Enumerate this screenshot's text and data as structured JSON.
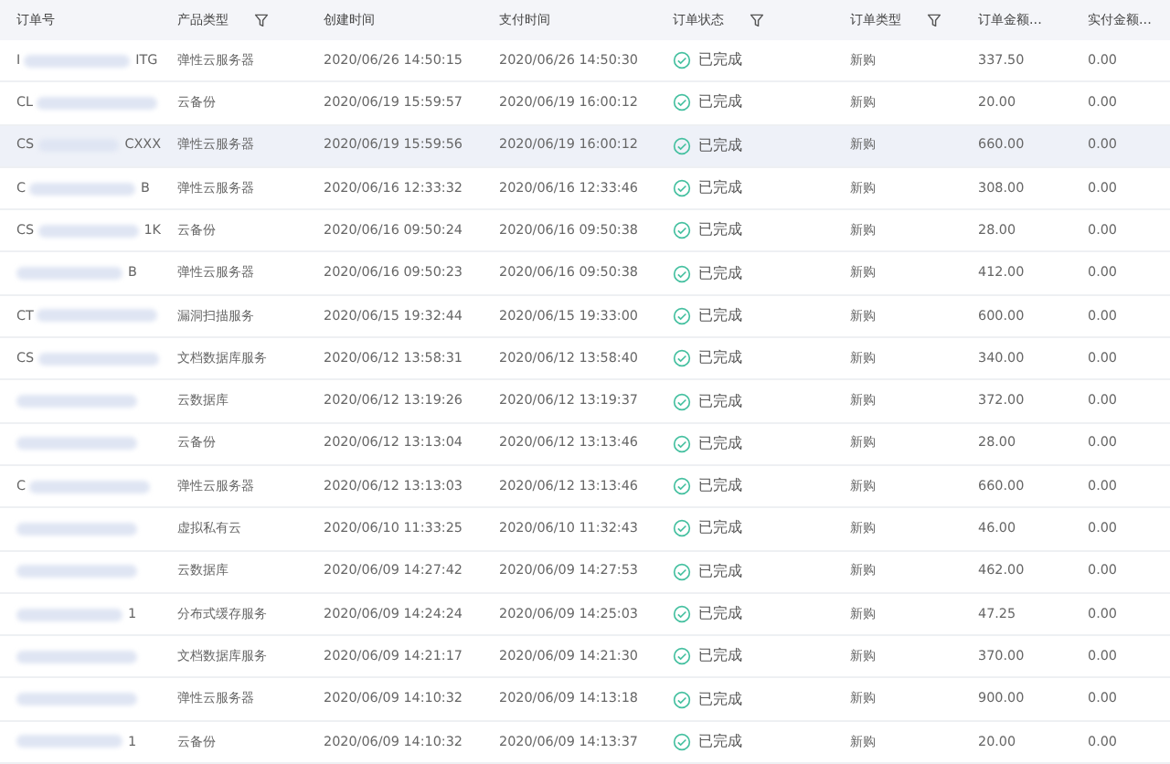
{
  "table": {
    "columns": [
      {
        "label": "订单号",
        "filter": false
      },
      {
        "label": "产品类型",
        "filter": true
      },
      {
        "label": "创建时间",
        "filter": false
      },
      {
        "label": "支付时间",
        "filter": false
      },
      {
        "label": "订单状态",
        "filter": true
      },
      {
        "label": "订单类型",
        "filter": true
      },
      {
        "label": "订单金额...",
        "filter": false
      },
      {
        "label": "实付金额...",
        "filter": false
      }
    ],
    "rows": [
      {
        "order_start": "I",
        "order_end": "ITG",
        "product": "弹性云服务器",
        "created": "2020/06/26 14:50:15",
        "paid": "2020/06/26 14:50:30",
        "status": "已完成",
        "order_type": "新购",
        "amount": "337.50",
        "paid_amount": "0.00",
        "selected": false
      },
      {
        "order_start": "CL",
        "product": "云备份",
        "created": "2020/06/19 15:59:57",
        "paid": "2020/06/19 16:00:12",
        "status": "已完成",
        "order_type": "新购",
        "amount": "20.00",
        "paid_amount": "0.00",
        "selected": false
      },
      {
        "order_start": "CS",
        "order_end": "CXXX",
        "product": "弹性云服务器",
        "created": "2020/06/19 15:59:56",
        "paid": "2020/06/19 16:00:12",
        "status": "已完成",
        "order_type": "新购",
        "amount": "660.00",
        "paid_amount": "0.00",
        "selected": true
      },
      {
        "order_start": "C",
        "order_end": "B",
        "product": "弹性云服务器",
        "created": "2020/06/16 12:33:32",
        "paid": "2020/06/16 12:33:46",
        "status": "已完成",
        "order_type": "新购",
        "amount": "308.00",
        "paid_amount": "0.00",
        "selected": false
      },
      {
        "order_start": "CS",
        "order_end": "1K",
        "product": "云备份",
        "created": "2020/06/16 09:50:24",
        "paid": "2020/06/16 09:50:38",
        "status": "已完成",
        "order_type": "新购",
        "amount": "28.00",
        "paid_amount": "0.00",
        "selected": false
      },
      {
        "order_end": "B",
        "product": "弹性云服务器",
        "created": "2020/06/16 09:50:23",
        "paid": "2020/06/16 09:50:38",
        "status": "已完成",
        "order_type": "新购",
        "amount": "412.00",
        "paid_amount": "0.00",
        "selected": false
      },
      {
        "order_start": "CT",
        "product": "漏洞扫描服务",
        "created": "2020/06/15 19:32:44",
        "paid": "2020/06/15 19:33:00",
        "status": "已完成",
        "order_type": "新购",
        "amount": "600.00",
        "paid_amount": "0.00",
        "selected": false
      },
      {
        "order_start": "CS",
        "product": "文档数据库服务",
        "created": "2020/06/12 13:58:31",
        "paid": "2020/06/12 13:58:40",
        "status": "已完成",
        "order_type": "新购",
        "amount": "340.00",
        "paid_amount": "0.00",
        "selected": false
      },
      {
        "product": "云数据库",
        "created": "2020/06/12 13:19:26",
        "paid": "2020/06/12 13:19:37",
        "status": "已完成",
        "order_type": "新购",
        "amount": "372.00",
        "paid_amount": "0.00",
        "selected": false
      },
      {
        "product": "云备份",
        "created": "2020/06/12 13:13:04",
        "paid": "2020/06/12 13:13:46",
        "status": "已完成",
        "order_type": "新购",
        "amount": "28.00",
        "paid_amount": "0.00",
        "selected": false
      },
      {
        "order_start": "C",
        "product": "弹性云服务器",
        "created": "2020/06/12 13:13:03",
        "paid": "2020/06/12 13:13:46",
        "status": "已完成",
        "order_type": "新购",
        "amount": "660.00",
        "paid_amount": "0.00",
        "selected": false
      },
      {
        "product": "虚拟私有云",
        "created": "2020/06/10 11:33:25",
        "paid": "2020/06/10 11:32:43",
        "status": "已完成",
        "order_type": "新购",
        "amount": "46.00",
        "paid_amount": "0.00",
        "selected": false
      },
      {
        "product": "云数据库",
        "created": "2020/06/09 14:27:42",
        "paid": "2020/06/09 14:27:53",
        "status": "已完成",
        "order_type": "新购",
        "amount": "462.00",
        "paid_amount": "0.00",
        "selected": false
      },
      {
        "order_end": "1",
        "product": "分布式缓存服务",
        "created": "2020/06/09 14:24:24",
        "paid": "2020/06/09 14:25:03",
        "status": "已完成",
        "order_type": "新购",
        "amount": "47.25",
        "paid_amount": "0.00",
        "selected": false
      },
      {
        "product": "文档数据库服务",
        "created": "2020/06/09 14:21:17",
        "paid": "2020/06/09 14:21:30",
        "status": "已完成",
        "order_type": "新购",
        "amount": "370.00",
        "paid_amount": "0.00",
        "selected": false
      },
      {
        "product": "弹性云服务器",
        "created": "2020/06/09 14:10:32",
        "paid": "2020/06/09 14:13:18",
        "status": "已完成",
        "order_type": "新购",
        "amount": "900.00",
        "paid_amount": "0.00",
        "selected": false
      },
      {
        "order_end": "1",
        "product": "云备份",
        "created": "2020/06/09 14:10:32",
        "paid": "2020/06/09 14:13:37",
        "status": "已完成",
        "order_type": "新购",
        "amount": "20.00",
        "paid_amount": "0.00",
        "selected": false
      }
    ]
  }
}
